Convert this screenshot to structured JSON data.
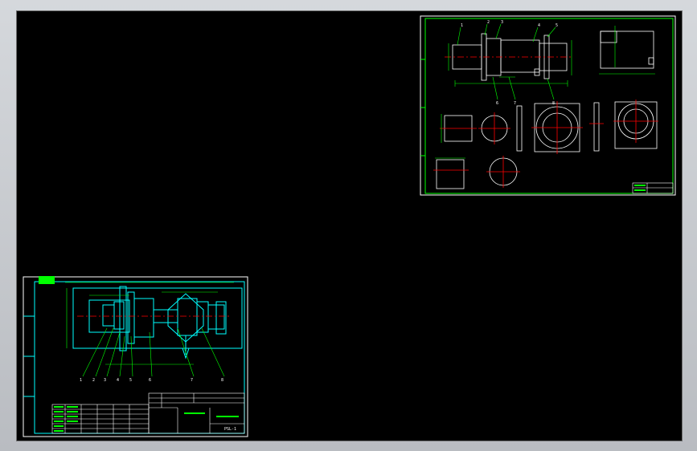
{
  "drawing_parts": {
    "title_block": {
      "part_code": "PSL-1",
      "legend_rows": [
        "1",
        "2",
        "3",
        "4",
        "5",
        "6"
      ]
    },
    "small_sheet": {
      "balloons": [
        "1",
        "2",
        "3",
        "4",
        "5",
        "6",
        "7",
        "8"
      ]
    },
    "part_sheet": {
      "balloons": [
        "1",
        "2",
        "3",
        "4",
        "5",
        "6",
        "7",
        "8"
      ]
    }
  },
  "colors": {
    "canvas": "#000000",
    "frame": "#00ffff",
    "border": "#ffffff",
    "dimension": "#00ff00",
    "centerline": "#ff0000",
    "title_fill": "#00ff00"
  }
}
